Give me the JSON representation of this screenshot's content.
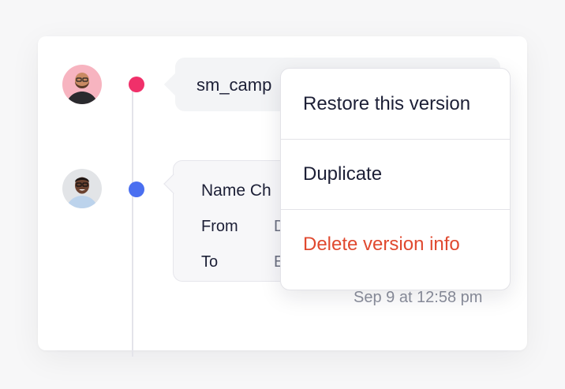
{
  "timeline": {
    "entries": [
      {
        "avatar_icon": "person-avatar-bearded",
        "dot_color": "#f0306a",
        "message": "sm_camp"
      },
      {
        "avatar_icon": "person-avatar-smiling",
        "dot_color": "#4a6ff0",
        "title": "Name Ch",
        "rows": [
          {
            "label": "From",
            "value": "D"
          },
          {
            "label": "To",
            "value": "E"
          }
        ],
        "timestamp": "Sep 9 at 12:58 pm"
      }
    ]
  },
  "context_menu": {
    "items": [
      {
        "label": "Restore this version",
        "color": "#1c1f36"
      },
      {
        "label": "Duplicate",
        "color": "#1c1f36"
      },
      {
        "label": "Delete version info",
        "color": "#e0492f"
      }
    ]
  }
}
